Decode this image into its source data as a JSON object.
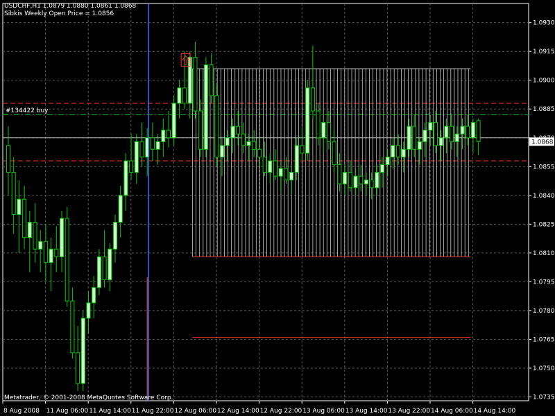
{
  "header": {
    "title": "USDCHF,H1  1.0879 1.0880 1.0861 1.0868",
    "indicator": "Sibkis Weekly Open Price = 1.0856"
  },
  "footer": {
    "copyright": "Metatrader, © 2001-2008 MetaQuotes Software Corp."
  },
  "order": {
    "label": "#134422 buy"
  },
  "colors": {
    "background": "#000000",
    "grid": "#5a5a5a",
    "candle_bull": "#ccffcc",
    "candle_bear": "#000000",
    "wick": "#00cc00",
    "axis_text": "#ffffff",
    "red_line": "#ff3030",
    "green_dashdot": "#00a000",
    "blue_line": "#3a6cff",
    "rect": "#cccccc"
  },
  "chart_data": {
    "type": "candlestick",
    "symbol": "USDCHF",
    "timeframe": "H1",
    "ylim": [
      1.0733,
      1.094
    ],
    "y_ticks": [
      "1.0930",
      "1.0915",
      "1.0900",
      "1.0885",
      "1.0870",
      "1.0855",
      "1.0840",
      "1.0825",
      "1.0810",
      "1.0795",
      "1.0780",
      "1.0765",
      "1.0750",
      "1.0735"
    ],
    "x_ticks": [
      "8 Aug 2008",
      "11 Aug 06:00",
      "11 Aug 14:00",
      "11 Aug 22:00",
      "12 Aug 06:00",
      "12 Aug 14:00",
      "12 Aug 22:00",
      "13 Aug 06:00",
      "13 Aug 14:00",
      "13 Aug 22:00",
      "14 Aug 06:00",
      "14 Aug 14:00"
    ],
    "bars_per_tick": 8,
    "current_price": "1.0868",
    "grid": true,
    "levels": {
      "red_dashed": [
        1.0888,
        1.0858
      ],
      "green_dashdot": [
        1.0882
      ],
      "grey_line": [
        1.087
      ],
      "red_solid": [
        1.0808,
        1.0766
      ]
    },
    "price_box": {
      "high": 1.0906,
      "low": 1.0808,
      "start_bar": 35,
      "end_bar": 86
    },
    "arrow": {
      "bar": 33,
      "price": 1.0912
    },
    "vertical_line_bar": 26,
    "candles": [
      [
        1.0866,
        1.0876,
        1.084,
        1.0852
      ],
      [
        1.0852,
        1.086,
        1.082,
        1.083
      ],
      [
        1.083,
        1.0848,
        1.081,
        1.0838
      ],
      [
        1.0838,
        1.0845,
        1.0812,
        1.0818
      ],
      [
        1.0818,
        1.0832,
        1.08,
        1.0826
      ],
      [
        1.0826,
        1.0836,
        1.0805,
        1.0812
      ],
      [
        1.0812,
        1.0822,
        1.08,
        1.0816
      ],
      [
        1.0816,
        1.0825,
        1.0795,
        1.0805
      ],
      [
        1.0805,
        1.0818,
        1.079,
        1.0812
      ],
      [
        1.0812,
        1.0824,
        1.08,
        1.0808
      ],
      [
        1.0808,
        1.0832,
        1.08,
        1.0828
      ],
      [
        1.0828,
        1.0834,
        1.0782,
        1.0785
      ],
      [
        1.0785,
        1.0792,
        1.0755,
        1.0758
      ],
      [
        1.0758,
        1.0772,
        1.0738,
        1.0742
      ],
      [
        1.0742,
        1.078,
        1.0738,
        1.0776
      ],
      [
        1.0776,
        1.079,
        1.0768,
        1.0784
      ],
      [
        1.0784,
        1.0798,
        1.0776,
        1.0792
      ],
      [
        1.0792,
        1.0812,
        1.0788,
        1.0808
      ],
      [
        1.0808,
        1.0822,
        1.0792,
        1.0796
      ],
      [
        1.0796,
        1.0815,
        1.079,
        1.0812
      ],
      [
        1.0812,
        1.083,
        1.0805,
        1.0826
      ],
      [
        1.0826,
        1.0845,
        1.0818,
        1.084
      ],
      [
        1.084,
        1.0862,
        1.0832,
        1.0858
      ],
      [
        1.0858,
        1.0872,
        1.0848,
        1.0852
      ],
      [
        1.0852,
        1.0872,
        1.0846,
        1.0868
      ],
      [
        1.0868,
        1.0878,
        1.0855,
        1.086
      ],
      [
        1.086,
        1.0875,
        1.085,
        1.087
      ],
      [
        1.087,
        1.0878,
        1.0858,
        1.0864
      ],
      [
        1.0864,
        1.0872,
        1.0856,
        1.0868
      ],
      [
        1.0868,
        1.088,
        1.086,
        1.0874
      ],
      [
        1.0874,
        1.0884,
        1.0865,
        1.087
      ],
      [
        1.087,
        1.0892,
        1.0866,
        1.0888
      ],
      [
        1.0888,
        1.09,
        1.088,
        1.0896
      ],
      [
        1.0896,
        1.0915,
        1.0885,
        1.0888
      ],
      [
        1.0888,
        1.0915,
        1.088,
        1.0912
      ],
      [
        1.0912,
        1.092,
        1.088,
        1.0884
      ],
      [
        1.0884,
        1.089,
        1.086,
        1.0864
      ],
      [
        1.0864,
        1.0912,
        1.086,
        1.0908
      ],
      [
        1.0908,
        1.0914,
        1.0888,
        1.0892
      ],
      [
        1.0892,
        1.0898,
        1.0855,
        1.086
      ],
      [
        1.086,
        1.087,
        1.085,
        1.0866
      ],
      [
        1.0866,
        1.0874,
        1.0858,
        1.087
      ],
      [
        1.087,
        1.088,
        1.0862,
        1.0876
      ],
      [
        1.0876,
        1.0884,
        1.0866,
        1.0872
      ],
      [
        1.0872,
        1.0878,
        1.0862,
        1.0866
      ],
      [
        1.0866,
        1.0872,
        1.0858,
        1.0868
      ],
      [
        1.0868,
        1.0874,
        1.086,
        1.0864
      ],
      [
        1.0864,
        1.087,
        1.0855,
        1.086
      ],
      [
        1.086,
        1.0868,
        1.085,
        1.0852
      ],
      [
        1.0852,
        1.0862,
        1.0846,
        1.0858
      ],
      [
        1.0858,
        1.0864,
        1.0848,
        1.085
      ],
      [
        1.085,
        1.0858,
        1.0842,
        1.0854
      ],
      [
        1.0854,
        1.086,
        1.0846,
        1.0848
      ],
      [
        1.0848,
        1.0856,
        1.084,
        1.0852
      ],
      [
        1.0852,
        1.087,
        1.0848,
        1.0866
      ],
      [
        1.0866,
        1.0876,
        1.0858,
        1.0862
      ],
      [
        1.0862,
        1.09,
        1.0858,
        1.0896
      ],
      [
        1.0896,
        1.0918,
        1.088,
        1.0884
      ],
      [
        1.0884,
        1.0888,
        1.0866,
        1.087
      ],
      [
        1.087,
        1.088,
        1.0862,
        1.0878
      ],
      [
        1.0878,
        1.0884,
        1.0864,
        1.0868
      ],
      [
        1.0868,
        1.0874,
        1.0852,
        1.0856
      ],
      [
        1.0856,
        1.0862,
        1.0842,
        1.0846
      ],
      [
        1.0846,
        1.0856,
        1.084,
        1.0852
      ],
      [
        1.0852,
        1.0858,
        1.0842,
        1.0844
      ],
      [
        1.0844,
        1.0854,
        1.084,
        1.085
      ],
      [
        1.085,
        1.0856,
        1.0842,
        1.0846
      ],
      [
        1.0846,
        1.0852,
        1.084,
        1.0848
      ],
      [
        1.0848,
        1.0852,
        1.0838,
        1.0844
      ],
      [
        1.0844,
        1.0856,
        1.084,
        1.0852
      ],
      [
        1.0852,
        1.086,
        1.0844,
        1.0856
      ],
      [
        1.0856,
        1.0864,
        1.085,
        1.086
      ],
      [
        1.086,
        1.087,
        1.0854,
        1.0866
      ],
      [
        1.0866,
        1.0872,
        1.0856,
        1.086
      ],
      [
        1.086,
        1.0868,
        1.0852,
        1.0864
      ],
      [
        1.0864,
        1.088,
        1.086,
        1.0876
      ],
      [
        1.0876,
        1.0882,
        1.086,
        1.0864
      ],
      [
        1.0864,
        1.087,
        1.0856,
        1.0868
      ],
      [
        1.0868,
        1.0878,
        1.086,
        1.0874
      ],
      [
        1.0874,
        1.0882,
        1.0866,
        1.0878
      ],
      [
        1.0878,
        1.0884,
        1.0862,
        1.0866
      ],
      [
        1.0866,
        1.0874,
        1.0858,
        1.087
      ],
      [
        1.087,
        1.088,
        1.0862,
        1.0876
      ],
      [
        1.0876,
        1.0882,
        1.0864,
        1.0868
      ],
      [
        1.0868,
        1.0876,
        1.086,
        1.0872
      ],
      [
        1.0872,
        1.088,
        1.0864,
        1.0876
      ],
      [
        1.0876,
        1.0882,
        1.0866,
        1.087
      ],
      [
        1.087,
        1.088,
        1.0862,
        1.0878
      ],
      [
        1.0879,
        1.088,
        1.0861,
        1.0868
      ]
    ]
  }
}
